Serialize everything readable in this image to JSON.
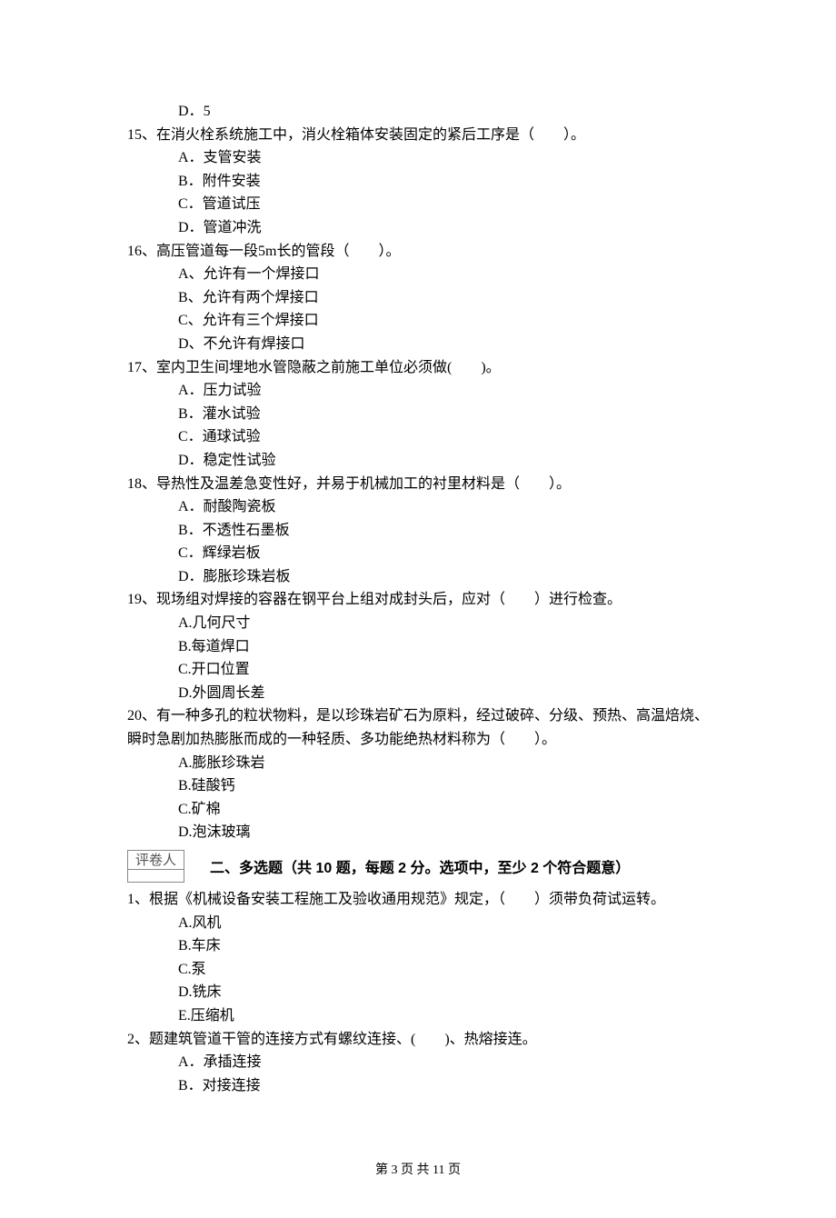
{
  "q14": {
    "d_label": "D．",
    "d": "5"
  },
  "q15": {
    "stem": "15、在消火栓系统施工中，消火栓箱体安装固定的紧后工序是（　　）。",
    "a": "A．支管安装",
    "b": "B．附件安装",
    "c": "C．管道试压",
    "d": "D．管道冲洗"
  },
  "q16": {
    "stem": "16、高压管道每一段5m长的管段（　　）。",
    "a": "A、允许有一个焊接口",
    "b": "B、允许有两个焊接口",
    "c": "C、允许有三个焊接口",
    "d": "D、不允许有焊接口"
  },
  "q17": {
    "stem": "17、室内卫生间埋地水管隐蔽之前施工单位必须做(　　)。",
    "a": "A．压力试验",
    "b": "B．灌水试验",
    "c": "C．通球试验",
    "d": "D．稳定性试验"
  },
  "q18": {
    "stem": "18、导热性及温差急变性好，并易于机械加工的衬里材料是（　　）。",
    "a": "A．耐酸陶瓷板",
    "b": "B．不透性石墨板",
    "c": "C．辉绿岩板",
    "d": "D．膨胀珍珠岩板"
  },
  "q19": {
    "stem": "19、现场组对焊接的容器在钢平台上组对成封头后，应对（　　）进行检查。",
    "a": "A.几何尺寸",
    "b": "B.每道焊口",
    "c": "C.开口位置",
    "d": "D.外圆周长差"
  },
  "q20": {
    "stem1": "20、有一种多孔的粒状物料，是以珍珠岩矿石为原料，经过破碎、分级、预热、高温焙烧、",
    "stem2": "瞬时急剧加热膨胀而成的一种轻质、多功能绝热材料称为（　　）。",
    "a": "A.膨胀珍珠岩",
    "b": "B.硅酸钙",
    "c": "C.矿棉",
    "d": "D.泡沫玻璃"
  },
  "grader_label": "评卷人",
  "section2_title": "二、多选题（共 10 题，每题 2 分。选项中，至少 2 个符合题意）",
  "mq1": {
    "stem": "1、根据《机械设备安装工程施工及验收通用规范》规定，（　　）须带负荷试运转。",
    "a": "A.风机",
    "b": "B.车床",
    "c": "C.泵",
    "d": "D.铣床",
    "e": "E.压缩机"
  },
  "mq2": {
    "stem": "2、题建筑管道干管的连接方式有螺纹连接、(　　)、热熔接连。",
    "a": "A．承插连接",
    "b": "B．对接连接"
  },
  "footer": "第 3 页 共 11 页"
}
